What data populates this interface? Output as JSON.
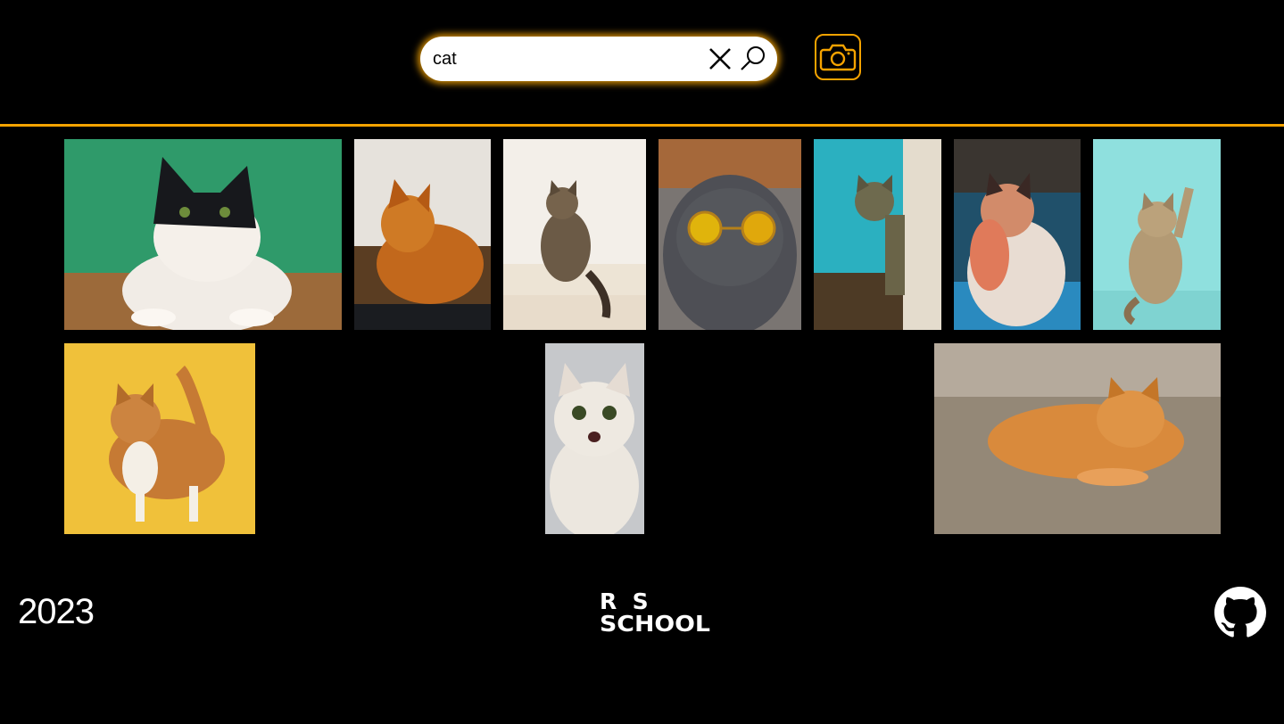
{
  "search": {
    "value": "cat",
    "clear_icon": "close-icon",
    "search_icon": "search-icon"
  },
  "camera": {
    "icon": "camera-icon"
  },
  "colors": {
    "accent": "#f5a300",
    "background": "#000000"
  },
  "gallery": {
    "images": [
      {
        "subject": "black-and-white cat on green background"
      },
      {
        "subject": "orange long-haired cat lying on wooden table"
      },
      {
        "subject": "tabby cat sitting on white stairs"
      },
      {
        "subject": "grey scottish fold cat with yellow sunglasses"
      },
      {
        "subject": "tabby cat peeking around blue door"
      },
      {
        "subject": "fluffy calico cat in colored light"
      },
      {
        "subject": "tabby kitten raising paw on turquoise background"
      },
      {
        "subject": "orange and white cat on yellow background"
      },
      {
        "subject": "white kitten with surprised face"
      },
      {
        "subject": "orange tabby cat lying on wooden floor"
      }
    ]
  },
  "footer": {
    "year": "2023",
    "logo_line1": "R  S",
    "logo_line2": "SCHOOL",
    "github_icon": "github-icon"
  }
}
